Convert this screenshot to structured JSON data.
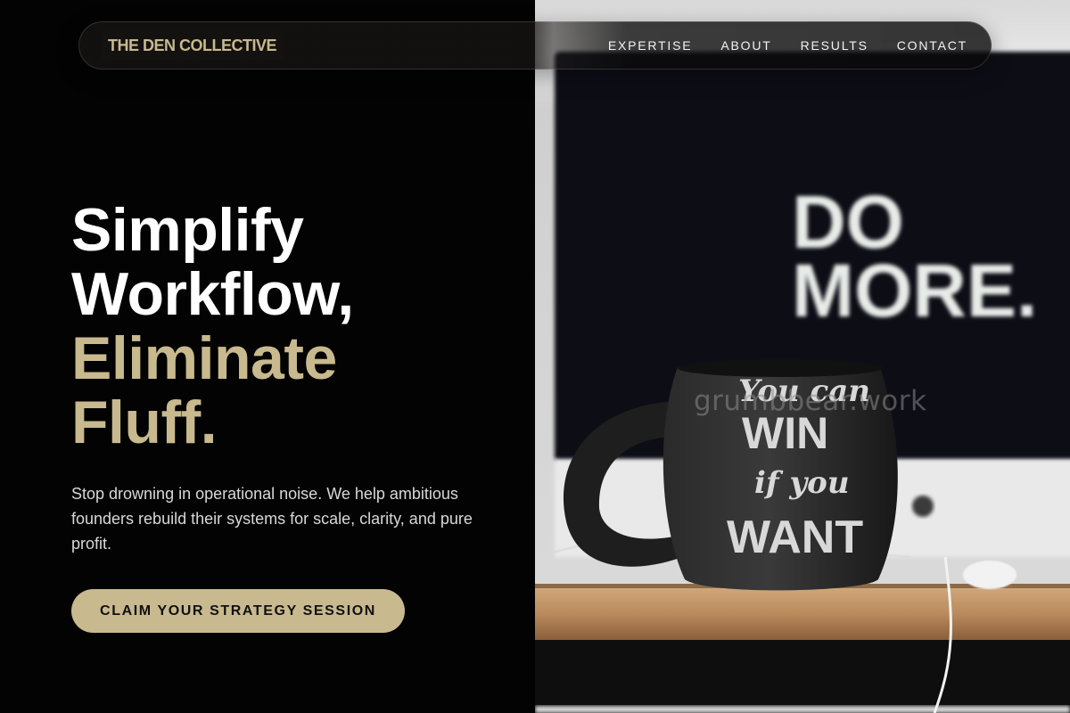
{
  "brand": {
    "name": "THE DEN COLLECTIVE"
  },
  "nav": {
    "links": [
      {
        "label": "EXPERTISE"
      },
      {
        "label": "ABOUT"
      },
      {
        "label": "RESULTS"
      },
      {
        "label": "CONTACT"
      }
    ]
  },
  "hero": {
    "headline": {
      "line1": "Simplify",
      "line2": "Workflow,",
      "line3": "Eliminate",
      "line4": "Fluff."
    },
    "subtitle": "Stop drowning in operational noise. We help ambitious founders rebuild their systems for scale, clarity, and pure profit.",
    "cta_label": "CLAIM YOUR STRATEGY SESSION"
  },
  "photo": {
    "screen_text_1": "DO",
    "screen_text_2": "MORE.",
    "mug_text_1": "You can",
    "mug_text_2": "WIN",
    "mug_text_3": "if you",
    "mug_text_4": "WANT"
  },
  "watermark": "grumbbear.work",
  "colors": {
    "accent": "#c8b98e",
    "background": "#030303"
  }
}
